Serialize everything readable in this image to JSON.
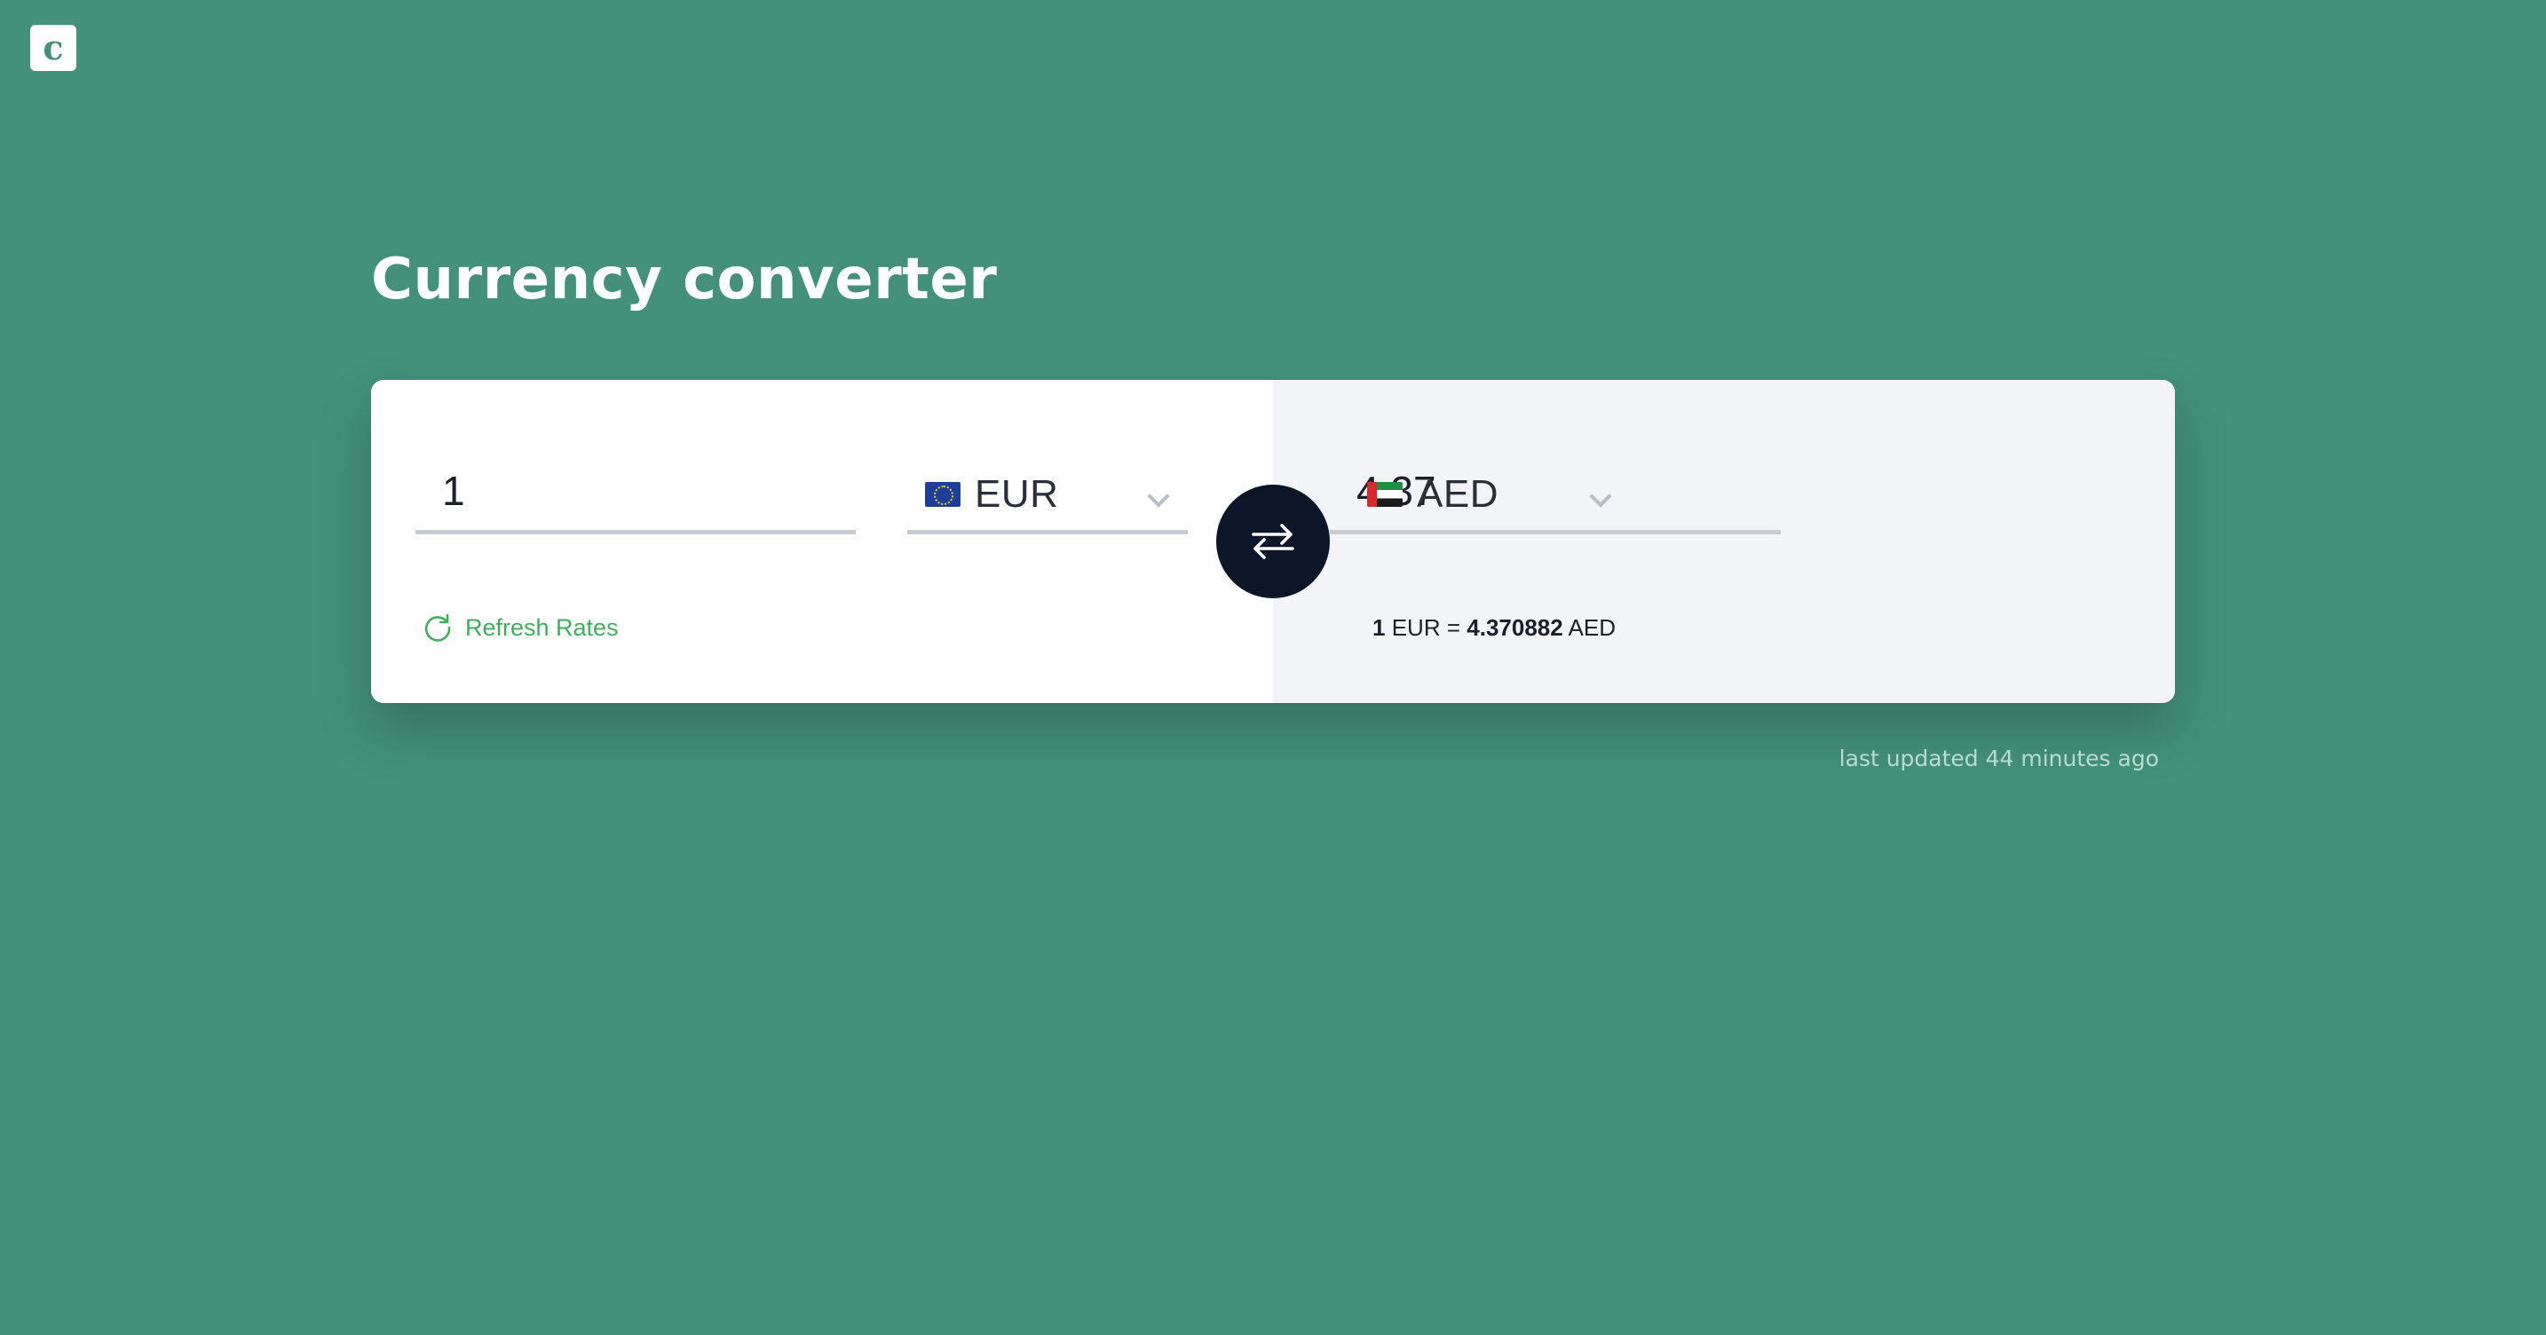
{
  "app": {
    "logo_letter": "c",
    "title": "Currency converter"
  },
  "converter": {
    "from": {
      "amount": "1",
      "currency": "EUR",
      "flag_icon": "eu-flag-icon"
    },
    "to": {
      "amount": "4.37",
      "currency": "AED",
      "flag_icon": "uae-flag-icon"
    },
    "swap_icon": "swap-arrows-icon",
    "refresh_label": "Refresh Rates",
    "refresh_icon": "refresh-icon",
    "rate": {
      "from_amount": "1",
      "from_code": "EUR",
      "equals": "=",
      "to_amount": "4.370882",
      "to_code": "AED"
    }
  },
  "footer": {
    "last_updated": "last updated 44 minutes ago"
  },
  "colors": {
    "background": "#43917a",
    "accent_green": "#3fae5f",
    "swap_button": "#0d1528",
    "right_panel": "#f3f4f8"
  }
}
